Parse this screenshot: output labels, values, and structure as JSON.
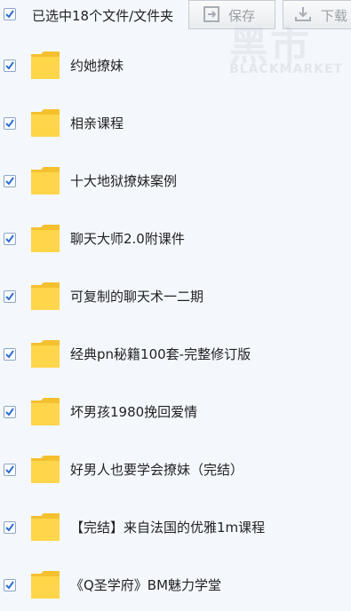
{
  "toolbar": {
    "selection_text": "已选中18个文件/文件夹",
    "save_label": "保存",
    "download_label": "下载"
  },
  "watermark": {
    "main": "黑市",
    "sub": "BLACKMARKET"
  },
  "files": [
    {
      "name": "约她撩妹",
      "checked": true
    },
    {
      "name": "相亲课程",
      "checked": true
    },
    {
      "name": "十大地狱撩妹案例",
      "checked": true
    },
    {
      "name": "聊天大师2.0附课件",
      "checked": true
    },
    {
      "name": "可复制的聊天术一二期",
      "checked": true
    },
    {
      "name": "经典pn秘籍100套-完整修订版",
      "checked": true
    },
    {
      "name": "坏男孩1980挽回爱情",
      "checked": true
    },
    {
      "name": "好男人也要学会撩妹（完结）",
      "checked": true
    },
    {
      "name": "【完结】来自法国的优雅1m课程",
      "checked": true
    },
    {
      "name": "《Q圣学府》BM魅力学堂",
      "checked": true
    }
  ],
  "colors": {
    "checkmark": "#2b6cd6",
    "folder": "#ffd54a",
    "background": "#f4f8fd"
  }
}
